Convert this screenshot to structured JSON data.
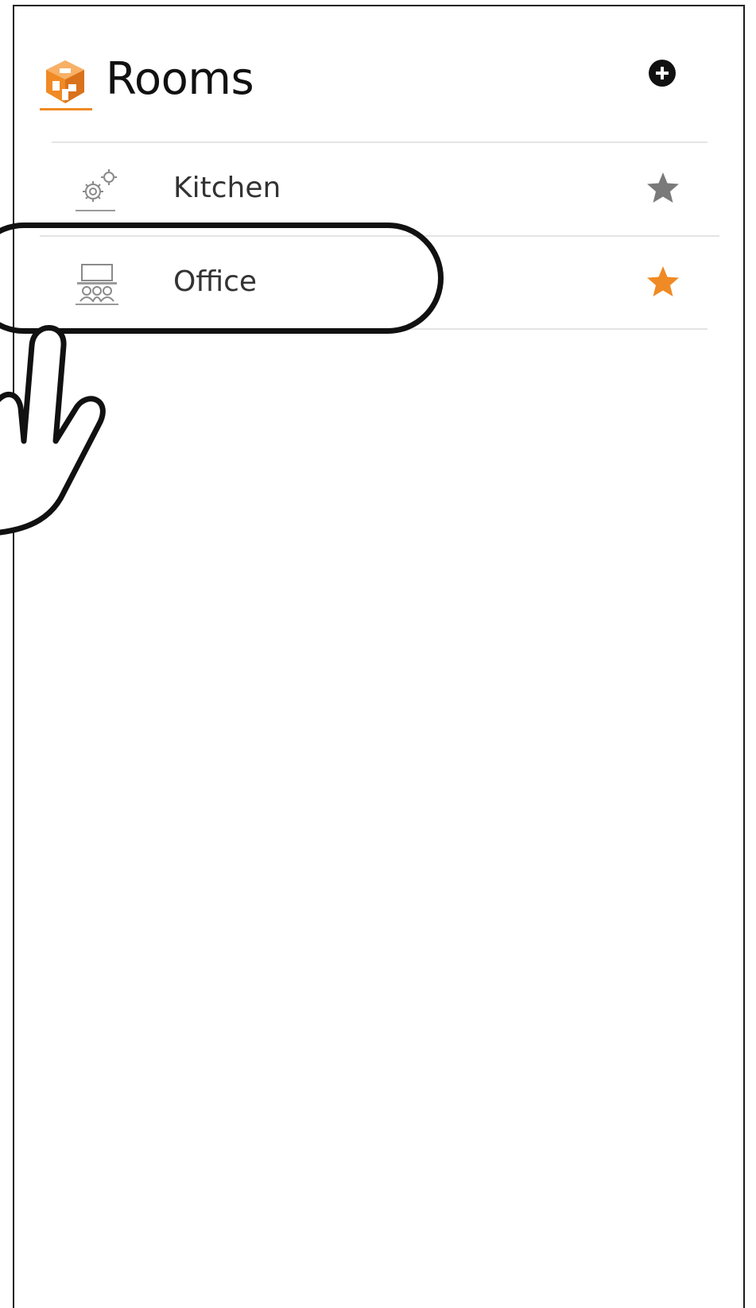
{
  "header": {
    "title": "Rooms",
    "logo_icon": "house-cube-icon",
    "add_icon": "plus-circle-icon"
  },
  "rooms": [
    {
      "label": "Kitchen",
      "icon": "gears-icon",
      "favorite": false
    },
    {
      "label": "Office",
      "icon": "office-meeting-icon",
      "favorite": true
    }
  ],
  "annotation": {
    "highlighted_item": "Office",
    "pointer_icon": "tap-hand-icon"
  },
  "colors": {
    "accent": "#f08a24",
    "star_inactive": "#7a7a7a",
    "star_active": "#f08a24",
    "title_text": "#111111",
    "item_text": "#333333",
    "divider": "#e4e4e4"
  }
}
